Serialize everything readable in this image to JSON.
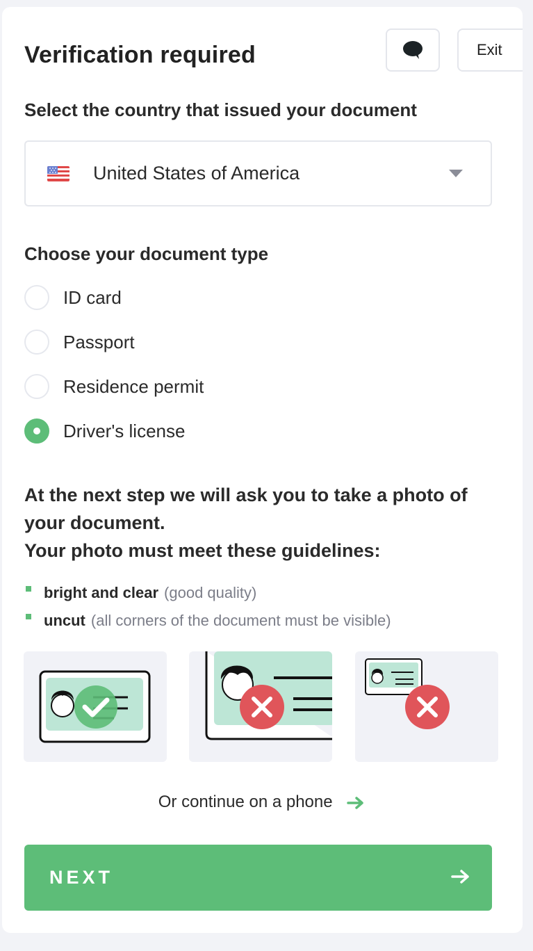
{
  "header": {
    "title": "Verification required",
    "chat_icon": "chat-bubble-icon",
    "exit_label": "Exit"
  },
  "country": {
    "label": "Select the country that issued your document",
    "selected": "United States of America",
    "flag_icon": "us-flag-icon"
  },
  "document_type": {
    "label": "Choose your document type",
    "options": [
      {
        "label": "ID card",
        "checked": false
      },
      {
        "label": "Passport",
        "checked": false
      },
      {
        "label": "Residence permit",
        "checked": false
      },
      {
        "label": "Driver's license",
        "checked": true
      }
    ]
  },
  "guidelines": {
    "intro_line1": "At the next step we will ask you to take a photo of your document.",
    "intro_line2": "Your photo must meet these guidelines:",
    "items": [
      {
        "strong": "bright and clear",
        "muted": "(good quality)"
      },
      {
        "strong": "uncut",
        "muted": "(all corners of the document must be visible)"
      }
    ],
    "examples": [
      {
        "name": "good-photo-example",
        "status": "correct"
      },
      {
        "name": "too-close-example",
        "status": "incorrect"
      },
      {
        "name": "too-far-example",
        "status": "incorrect"
      }
    ]
  },
  "phone_link": "Or continue on a phone",
  "next_button": "NEXT",
  "colors": {
    "accent": "#5dbd78",
    "error": "#e0555a",
    "doc_fill": "#bde6d6"
  }
}
